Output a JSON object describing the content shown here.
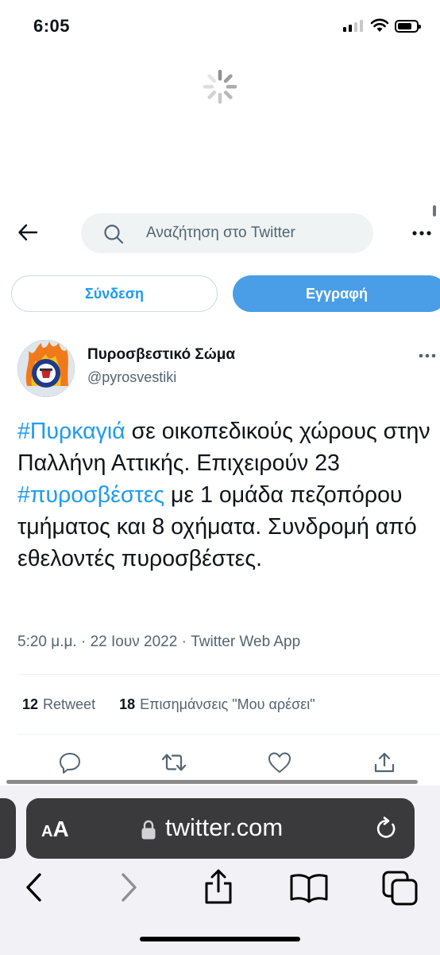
{
  "status_bar": {
    "time": "6:05"
  },
  "header": {
    "search_placeholder": "Αναζήτηση στο Twitter"
  },
  "auth": {
    "login_label": "Σύνδεση",
    "signup_label": "Εγγραφή"
  },
  "tweet": {
    "author_name": "Πυροσβεστικό Σώμα",
    "author_handle": "@pyrosvestiki",
    "text_parts": [
      {
        "text": "#Πυρκαγιά",
        "hashtag": true
      },
      {
        "text": " σε οικοπεδικούς χώρους στην Παλλήνη Αττικής. Επιχειρούν 23 ",
        "hashtag": false
      },
      {
        "text": "#πυροσβέστες",
        "hashtag": true
      },
      {
        "text": " με 1 ομάδα πεζοπόρου τμήματος και 8 οχήματα. Συνδρομή από εθελοντές πυροσβέστες.",
        "hashtag": false
      }
    ],
    "time": "5:20 μ.μ.",
    "date": "22 Ιουν 2022",
    "source": "Twitter Web App",
    "retweet_count": "12",
    "retweet_label": "Retweet",
    "like_count": "18",
    "like_label": "Επισημάνσεις \"Μου αρέσει\"",
    "actions": [
      "reply-icon",
      "retweet-icon",
      "like-icon",
      "share-icon"
    ]
  },
  "browser": {
    "aa_small": "A",
    "aa_big": "A",
    "url": "twitter.com"
  },
  "colors": {
    "accent": "#1d9bf0",
    "signup_bg": "#4a9ee8",
    "secondary_text": "#536471"
  }
}
